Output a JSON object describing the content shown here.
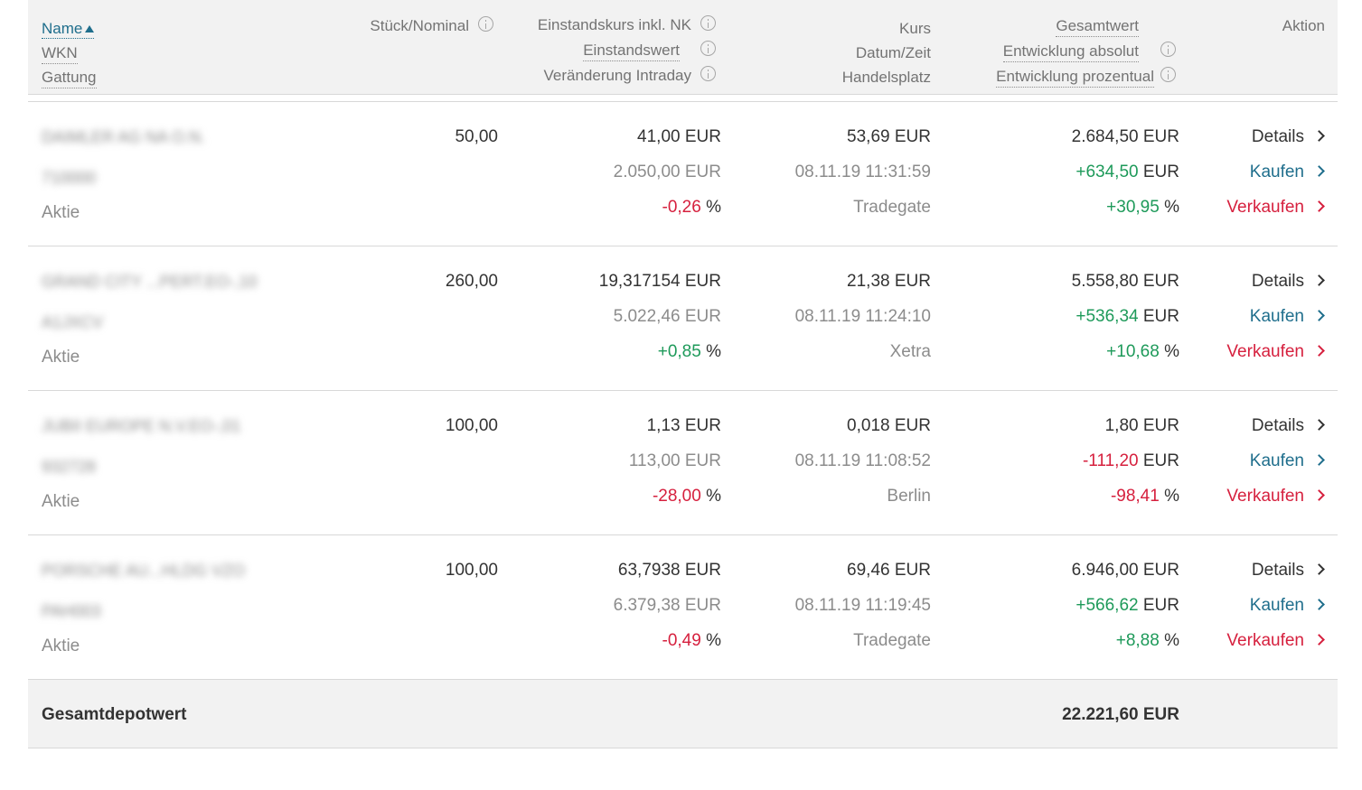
{
  "header": {
    "name": "Name",
    "wkn": "WKN",
    "gattung": "Gattung",
    "stueck": "Stück/Nominal",
    "einstandskurs": "Einstandskurs inkl. NK",
    "einstandswert": "Einstandswert",
    "veraenderung_intraday": "Veränderung Intraday",
    "kurs": "Kurs",
    "datum_zeit": "Datum/Zeit",
    "handelsplatz": "Handelsplatz",
    "gesamtwert": "Gesamtwert",
    "entwicklung_absolut": "Entwicklung absolut",
    "entwicklung_prozentual": "Entwicklung prozentual",
    "aktion": "Aktion"
  },
  "actions": {
    "details": "Details",
    "buy": "Kaufen",
    "sell": "Verkaufen"
  },
  "currency": "EUR",
  "percent": "%",
  "rows": [
    {
      "name": "DAIMLER AG NA O.N.",
      "wkn": "710000",
      "gattung": "Aktie",
      "stueck": "50,00",
      "einstandskurs": "41,00",
      "einstandswert": "2.050,00",
      "intraday": "-0,26",
      "intraday_trend": "neg",
      "kurs": "53,69",
      "datum": "08.11.19 11:31:59",
      "handelsplatz": "Tradegate",
      "gesamtwert": "2.684,50",
      "entw_abs": "+634,50",
      "entw_pct": "+30,95",
      "entw_trend": "pos"
    },
    {
      "name": "GRAND CITY ...PERT.EO-,10",
      "wkn": "A1JXCV",
      "gattung": "Aktie",
      "stueck": "260,00",
      "einstandskurs": "19,317154",
      "einstandswert": "5.022,46",
      "intraday": "+0,85",
      "intraday_trend": "pos",
      "kurs": "21,38",
      "datum": "08.11.19 11:24:10",
      "handelsplatz": "Xetra",
      "gesamtwert": "5.558,80",
      "entw_abs": "+536,34",
      "entw_pct": "+10,68",
      "entw_trend": "pos"
    },
    {
      "name": "JUBII EUROPE N.V.EO-,01",
      "wkn": "932728",
      "gattung": "Aktie",
      "stueck": "100,00",
      "einstandskurs": "1,13",
      "einstandswert": "113,00",
      "intraday": "-28,00",
      "intraday_trend": "neg",
      "kurs": "0,018",
      "datum": "08.11.19 11:08:52",
      "handelsplatz": "Berlin",
      "gesamtwert": "1,80",
      "entw_abs": "-111,20",
      "entw_pct": "-98,41",
      "entw_trend": "neg"
    },
    {
      "name": "PORSCHE AU...HLDG VZO",
      "wkn": "PAH003",
      "gattung": "Aktie",
      "stueck": "100,00",
      "einstandskurs": "63,7938",
      "einstandswert": "6.379,38",
      "intraday": "-0,49",
      "intraday_trend": "neg",
      "kurs": "69,46",
      "datum": "08.11.19 11:19:45",
      "handelsplatz": "Tradegate",
      "gesamtwert": "6.946,00",
      "entw_abs": "+566,62",
      "entw_pct": "+8,88",
      "entw_trend": "pos"
    }
  ],
  "footer": {
    "label": "Gesamtdepotwert",
    "total": "22.221,60 EUR"
  },
  "colors": {
    "positive": "#1e9a5a",
    "negative": "#d6203e",
    "link": "#1f6e8c",
    "header_bg": "#f2f2f2"
  },
  "icons": {
    "sort": "sort-ascending-icon",
    "info": "info-icon",
    "chevron": "chevron-right-icon"
  }
}
